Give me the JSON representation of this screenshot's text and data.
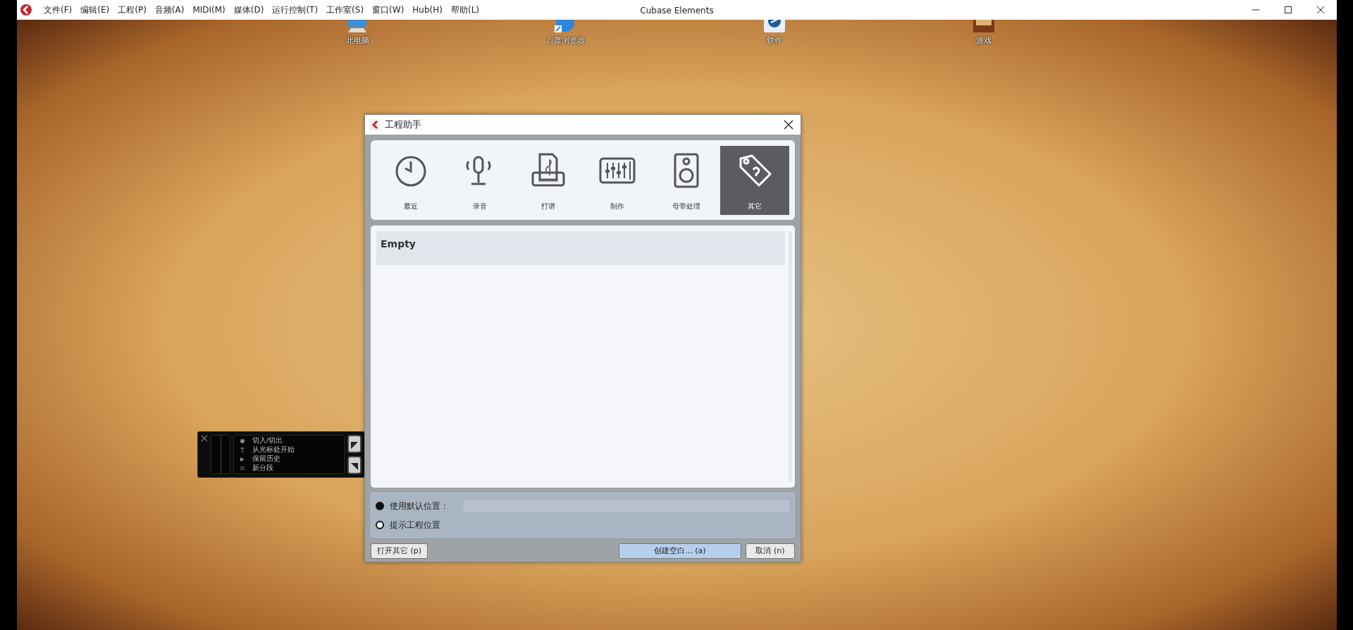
{
  "menubar": {
    "items": [
      {
        "label": "文件(F)"
      },
      {
        "label": "编辑(E)"
      },
      {
        "label": "工程(P)"
      },
      {
        "label": "音频(A)"
      },
      {
        "label": "MIDI(M)"
      },
      {
        "label": "媒体(D)"
      },
      {
        "label": "运行控制(T)"
      },
      {
        "label": "工作室(S)"
      },
      {
        "label": "窗口(W)"
      },
      {
        "label": "Hub(H)"
      },
      {
        "label": "帮助(L)"
      }
    ],
    "title": "Cubase Elements"
  },
  "desktop_icons": [
    {
      "label": "此电脑",
      "kind": "computer"
    },
    {
      "label": "百度浏览器",
      "kind": "browser"
    },
    {
      "label": "软件",
      "kind": "software"
    },
    {
      "label": "游戏",
      "kind": "game"
    }
  ],
  "transport": {
    "rows": [
      {
        "label": "切入/切出",
        "kind": "record"
      },
      {
        "label": "从光标处开始",
        "kind": "cursor"
      },
      {
        "label": "保留历史",
        "kind": "play"
      },
      {
        "label": "新分段",
        "kind": "split"
      }
    ]
  },
  "dialog": {
    "title": "工程助手",
    "categories": [
      {
        "label": "最近",
        "kind": "clock",
        "selected": false
      },
      {
        "label": "录音",
        "kind": "microphone",
        "selected": false
      },
      {
        "label": "打谱",
        "kind": "score",
        "selected": false
      },
      {
        "label": "制作",
        "kind": "mixer",
        "selected": false
      },
      {
        "label": "母带处理",
        "kind": "speaker",
        "selected": false
      },
      {
        "label": "其它",
        "kind": "tag",
        "selected": true
      }
    ],
    "templates": [
      {
        "label": "Empty",
        "selected": true
      }
    ],
    "location_options": [
      {
        "label": "使用默认位置：",
        "selected": true,
        "kind": "path"
      },
      {
        "label": "提示工程位置",
        "selected": false,
        "kind": "plain"
      }
    ],
    "buttons": [
      {
        "label": "打开其它 (p)",
        "kind": "secondary"
      },
      {
        "label": "创建空白... (a)",
        "kind": "primary"
      },
      {
        "label": "取消 (n)",
        "kind": "secondary"
      }
    ]
  }
}
